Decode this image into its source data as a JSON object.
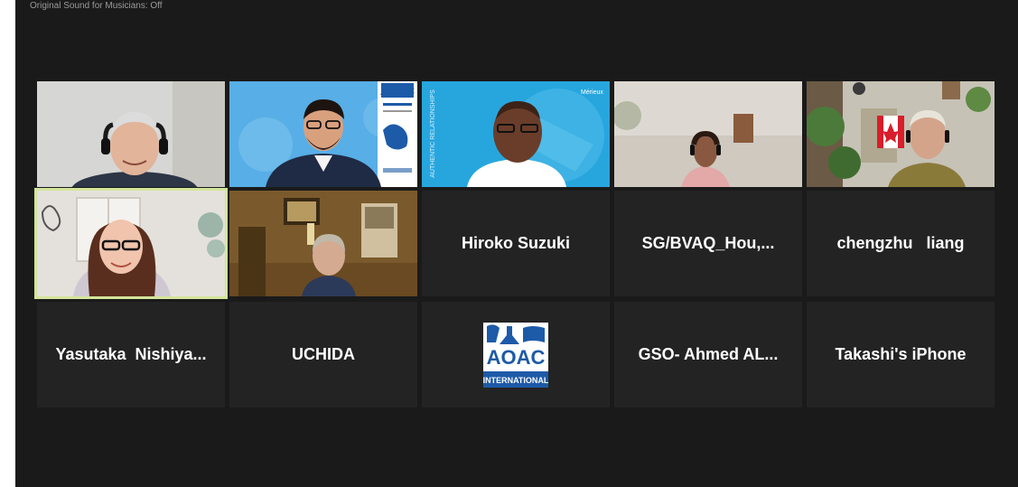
{
  "status_bar": {
    "text": "Original Sound for Musicians: Off"
  },
  "participants": [
    {
      "id": "p1",
      "name": "",
      "video": true
    },
    {
      "id": "p2",
      "name": "",
      "video": true
    },
    {
      "id": "p3",
      "name": "",
      "video": true
    },
    {
      "id": "p4",
      "name": "",
      "video": true
    },
    {
      "id": "p5",
      "name": "",
      "video": true
    },
    {
      "id": "p6",
      "name": "",
      "video": true,
      "active_speaker": true
    },
    {
      "id": "p7",
      "name": "",
      "video": true
    },
    {
      "id": "p8",
      "name": "Hiroko Suzuki",
      "video": false
    },
    {
      "id": "p9",
      "name": "SG/BVAQ_Hou,...",
      "video": false
    },
    {
      "id": "p10",
      "name": "chengzhu   liang",
      "video": false
    },
    {
      "id": "p11",
      "name": "Yasutaka  Nishiya...",
      "video": false
    },
    {
      "id": "p12",
      "name": "UCHIDA",
      "video": false
    },
    {
      "id": "p13",
      "name": "",
      "video": false,
      "avatar": "aoac-logo"
    },
    {
      "id": "p14",
      "name": "GSO- Ahmed AL...",
      "video": false
    },
    {
      "id": "p15",
      "name": "Takashi's iPhone",
      "video": false
    }
  ],
  "banner_text": {
    "aoac_sign": "AOAC",
    "merieux": "Mérieux",
    "authentic": "AUTHENTIC RELATIONSHIPS",
    "aoac_logo_main": "AOAC",
    "aoac_logo_sub": "INTERNATIONAL"
  },
  "colors": {
    "background": "#1a1a1a",
    "tile": "#232323",
    "active_border": "#d3e59b",
    "name_text": "#ffffff",
    "aoac_blue": "#1d5aa8"
  }
}
